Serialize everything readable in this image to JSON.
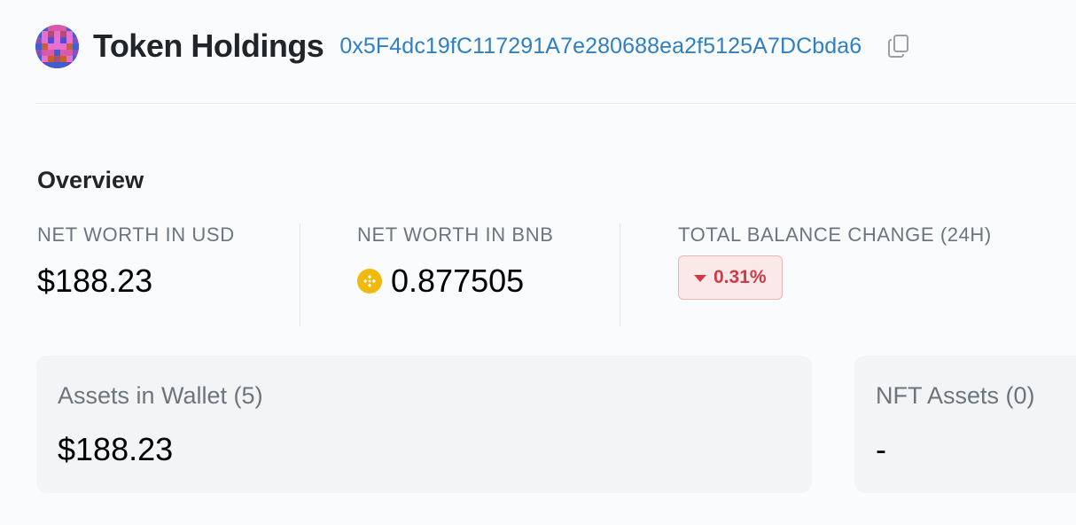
{
  "header": {
    "title": "Token Holdings",
    "address": "0x5F4dc19fC117291A7e280688ea2f5125A7DCbda6"
  },
  "icons": {
    "avatar": "identicon-avatar",
    "copy": "copy-icon",
    "bnb": "bnb-coin-icon",
    "caret": "caret-down-icon"
  },
  "colors": {
    "address_link": "#2f7fc1",
    "negative": "#cf3b44",
    "negative_bg": "#fbe9ea",
    "bnb_gold": "#f0b90b"
  },
  "overview": {
    "title": "Overview",
    "net_worth_usd": {
      "label": "NET WORTH IN USD",
      "value": "$188.23"
    },
    "net_worth_bnb": {
      "label": "NET WORTH IN BNB",
      "value": "0.877505"
    },
    "balance_change": {
      "label": "TOTAL BALANCE CHANGE (24H)",
      "value": "0.31%",
      "direction": "down"
    }
  },
  "cards": {
    "wallet": {
      "title": "Assets in Wallet (5)",
      "value": "$188.23"
    },
    "nft": {
      "title": "NFT Assets (0)",
      "value": "-"
    }
  }
}
